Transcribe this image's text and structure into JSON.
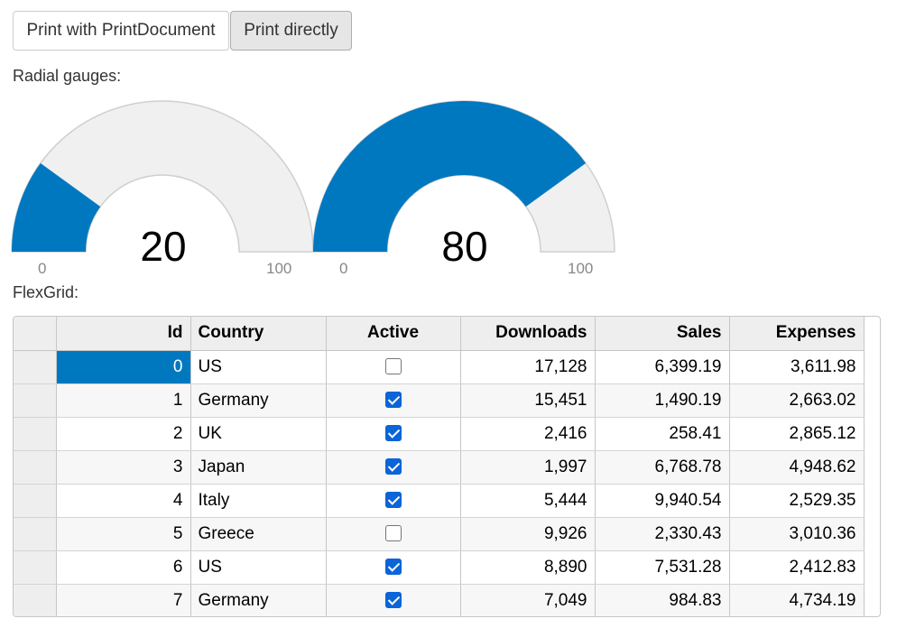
{
  "toolbar": {
    "print_document_label": "Print with PrintDocument",
    "print_directly_label": "Print directly"
  },
  "labels": {
    "gauges": "Radial gauges:",
    "grid": "FlexGrid:"
  },
  "colors": {
    "gauge_fill": "#0078c0",
    "gauge_track": "#f0f0f0",
    "selection": "#0078c0"
  },
  "gauges": [
    {
      "value": "20",
      "min": "0",
      "max": "100",
      "fraction": 0.2
    },
    {
      "value": "80",
      "min": "0",
      "max": "100",
      "fraction": 0.8
    }
  ],
  "grid": {
    "columns": [
      "Id",
      "Country",
      "Active",
      "Downloads",
      "Sales",
      "Expenses"
    ],
    "rows": [
      {
        "id": "0",
        "country": "US",
        "active": false,
        "downloads": "17,128",
        "sales": "6,399.19",
        "expenses": "3,611.98"
      },
      {
        "id": "1",
        "country": "Germany",
        "active": true,
        "downloads": "15,451",
        "sales": "1,490.19",
        "expenses": "2,663.02"
      },
      {
        "id": "2",
        "country": "UK",
        "active": true,
        "downloads": "2,416",
        "sales": "258.41",
        "expenses": "2,865.12"
      },
      {
        "id": "3",
        "country": "Japan",
        "active": true,
        "downloads": "1,997",
        "sales": "6,768.78",
        "expenses": "4,948.62"
      },
      {
        "id": "4",
        "country": "Italy",
        "active": true,
        "downloads": "5,444",
        "sales": "9,940.54",
        "expenses": "2,529.35"
      },
      {
        "id": "5",
        "country": "Greece",
        "active": false,
        "downloads": "9,926",
        "sales": "2,330.43",
        "expenses": "3,010.36"
      },
      {
        "id": "6",
        "country": "US",
        "active": true,
        "downloads": "8,890",
        "sales": "7,531.28",
        "expenses": "2,412.83"
      },
      {
        "id": "7",
        "country": "Germany",
        "active": true,
        "downloads": "7,049",
        "sales": "984.83",
        "expenses": "4,734.19"
      }
    ]
  }
}
